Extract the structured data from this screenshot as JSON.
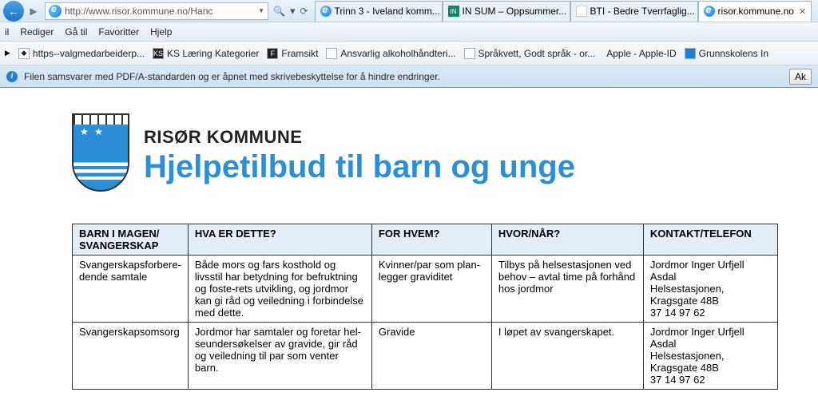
{
  "browser": {
    "url": "http://www.risor.kommune.no/Hanc",
    "tabs": [
      {
        "label": "Trinn 3 - Iveland komm...",
        "icon": "ie"
      },
      {
        "label": "IN SUM – Oppsummer...",
        "icon": "in"
      },
      {
        "label": "BTI - Bedre Tverrfaglig...",
        "icon": "bti"
      },
      {
        "label": "risor.kommune.no",
        "icon": "ie",
        "active": true
      }
    ]
  },
  "menubar": [
    "il",
    "Rediger",
    "Gå til",
    "Favoritter",
    "Hjelp"
  ],
  "favbar": [
    "https--valgmedarbeiderp...",
    "KS Læring Kategorier",
    "Framsikt",
    "Ansvarlig alkoholhåndteri...",
    "Språkvett, Godt språk - or...",
    "Apple - Apple-ID",
    "Grunnskolens In"
  ],
  "infobar": {
    "text": "Filen samsvarer med PDF/A-standarden og er åpnet med skrivebeskyttelse for å hindre endringer.",
    "button": "Ak"
  },
  "doc": {
    "org": "RISØR KOMMUNE",
    "title": "Hjelpetilbud til barn og unge",
    "columns": [
      "BARN I MAGEN/\nSVANGERSKAP",
      "HVA ER DETTE?",
      "FOR HVEM?",
      "HVOR/NÅR?",
      "KONTAKT/TELEFON"
    ],
    "rows": [
      {
        "c1": "Svangerskapsforbere-dende samtale",
        "c2": "Både mors og fars kosthold og livsstil har betydning for befruktning og foste-rets utvikling, og jordmor kan gi råd og veiledning i forbindelse med dette.",
        "c3": "Kvinner/par som plan-legger graviditet",
        "c4": "Tilbys på helsestasjonen ved behov – avtal time på forhånd hos jordmor",
        "c5": "Jordmor Inger Urfjell Asdal\nHelsestasjonen, Kragsgate 48B\n37 14 97 62"
      },
      {
        "c1": "Svangerskapsomsorg",
        "c2": "Jordmor har samtaler og foretar hel-seundersøkelser av gravide, gir råd og veiledning til par som venter barn.",
        "c3": "Gravide",
        "c4": "I løpet av svangerskapet.",
        "c5": "Jordmor Inger Urfjell Asdal\nHelsestasjonen, Kragsgate 48B\n37 14 97 62"
      }
    ]
  }
}
